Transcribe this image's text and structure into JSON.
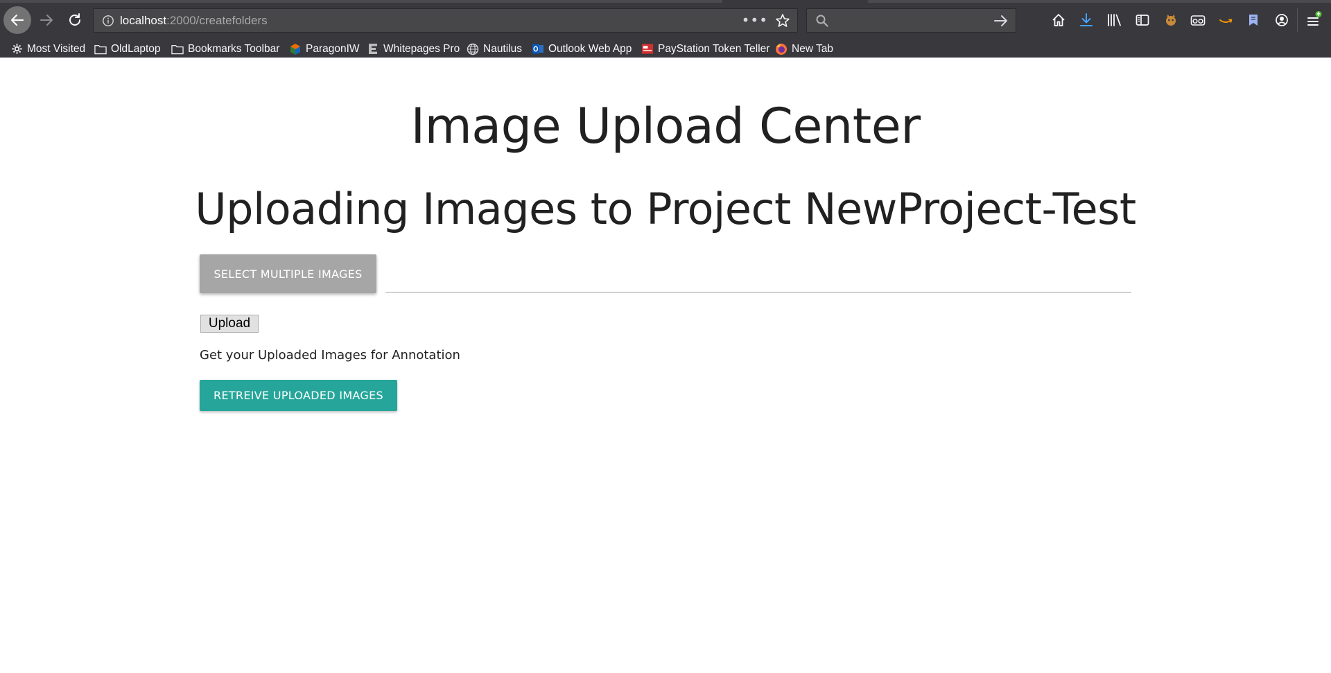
{
  "browser": {
    "url_host": "localhost",
    "url_path": ":2000/createfolders",
    "url_actions": "•••",
    "search_placeholder": "",
    "bookmarks": [
      {
        "label": "Most Visited",
        "icon": "gear-icon"
      },
      {
        "label": "OldLaptop",
        "icon": "folder-icon"
      },
      {
        "label": "Bookmarks Toolbar",
        "icon": "folder-icon"
      },
      {
        "label": "ParagonIW",
        "icon": "paragon-icon"
      },
      {
        "label": "Whitepages Pro",
        "icon": "whitepages-icon"
      },
      {
        "label": "Nautilus",
        "icon": "globe-icon"
      },
      {
        "label": "Outlook Web App",
        "icon": "outlook-icon"
      },
      {
        "label": "PayStation Token Teller",
        "icon": "paystation-icon"
      },
      {
        "label": "New Tab",
        "icon": "firefox-icon"
      }
    ],
    "toolbar_icons": [
      "home-icon",
      "download-icon",
      "library-icon",
      "sidebar-icon",
      "extension-icon",
      "pocket-icon",
      "amazon-icon",
      "bookmark-icon",
      "account-icon",
      "menu-icon"
    ],
    "colors": {
      "chrome_bg": "#38383d",
      "download_accent": "#45a1ff",
      "update_badge": "#57bd35"
    }
  },
  "page": {
    "title": "Image Upload Center",
    "subtitle": "Uploading Images to Project NewProject-Test",
    "select_button": "SELECT MULTIPLE IMAGES",
    "file_path_value": "",
    "upload_button": "Upload",
    "retrieve_prompt": "Get your Uploaded Images for Annotation",
    "retrieve_button": "RETREIVE UPLOADED IMAGES",
    "colors": {
      "select_button": "#a6a6a6",
      "retrieve_button": "#26a69a"
    }
  }
}
